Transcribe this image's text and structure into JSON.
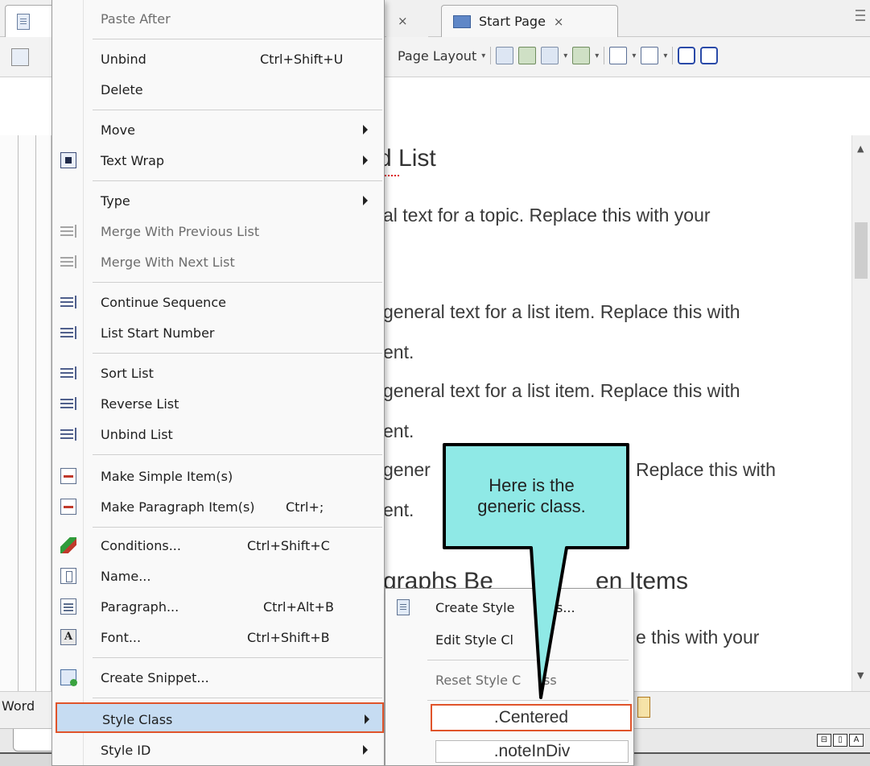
{
  "tabs": {
    "start_page_label": "Start Page",
    "close_glyph": "×"
  },
  "toolbar": {
    "page_layout_label": "Page Layout",
    "dropdown_glyph": "▾",
    "overflow_glyph": "▾"
  },
  "document": {
    "heading_1": "d List",
    "line_1": "al text for a topic. Replace this with your",
    "line_2": "general text for a list item. Replace this with",
    "line_3": "ent.",
    "line_4": "general text for a list item. Replace this with",
    "line_5": "ent.",
    "line_6a": "gener",
    "line_6b": "Replace this with",
    "line_7": "ent.",
    "heading_2a": "graphs Be",
    "heading_2b": "en Items",
    "line_8": "e this with your"
  },
  "status": {
    "word_label": "Word",
    "view_buttons": [
      "⊟",
      "▯",
      "A"
    ]
  },
  "context_menu": {
    "paste_after": "Paste After",
    "unbind": "Unbind",
    "unbind_shortcut": "Ctrl+Shift+U",
    "delete": "Delete",
    "move": "Move",
    "text_wrap": "Text Wrap",
    "type": "Type",
    "merge_previous": "Merge With Previous List",
    "merge_next": "Merge With Next List",
    "continue_sequence": "Continue Sequence",
    "list_start_number": "List Start Number",
    "sort_list": "Sort List",
    "reverse_list": "Reverse List",
    "unbind_list": "Unbind List",
    "make_simple_items": "Make Simple Item(s)",
    "make_paragraph_items": "Make Paragraph Item(s)",
    "make_paragraph_shortcut": "Ctrl+;",
    "conditions": "Conditions...",
    "conditions_shortcut": "Ctrl+Shift+C",
    "name": "Name...",
    "paragraph": "Paragraph...",
    "paragraph_shortcut": "Ctrl+Alt+B",
    "font": "Font...",
    "font_shortcut": "Ctrl+Shift+B",
    "font_icon_glyph": "A",
    "create_snippet": "Create Snippet...",
    "style_class": "Style Class",
    "style_id": "Style ID"
  },
  "submenu": {
    "create_style_class": "Create Style",
    "create_style_class_tail": "s...",
    "edit_style_class": "Edit Style Cl",
    "reset_style_class": "Reset Style C",
    "reset_style_class_tail": "ss",
    "class_centered": ".Centered",
    "class_noteindiv": ".noteInDiv"
  },
  "callout": {
    "line1": "Here is the",
    "line2": "generic class."
  },
  "colors": {
    "highlight_border": "#e0542b",
    "highlight_fill": "#c6dcf2",
    "callout_fill": "#8fe9e6"
  }
}
